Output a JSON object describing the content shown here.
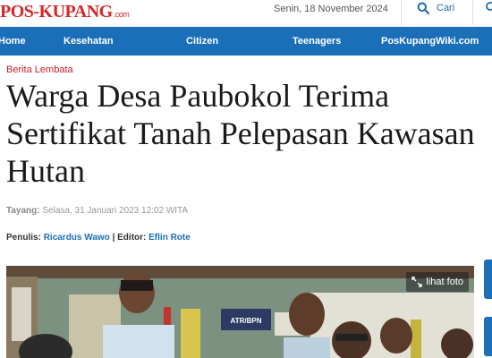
{
  "header": {
    "logo_text": "POS-KUPANG",
    "logo_suffix": ".com",
    "date": "Senin, 18 November 2024",
    "search_label": "Cari"
  },
  "nav": {
    "items": [
      {
        "label": "Home"
      },
      {
        "label": "Kesehatan"
      },
      {
        "label": "Citizen"
      },
      {
        "label": "Teenagers"
      },
      {
        "label": "PosKupangWiki.com"
      }
    ]
  },
  "article": {
    "section": "Berita Lembata",
    "title": "Warga Desa Paubokol Terima Sertifikat Tanah Pelepasan Kawasan Hutan",
    "tayang_label": "Tayang:",
    "tayang_value": "Selasa, 31 Januari 2023 12:02 WITA",
    "penulis_label": "Penulis:",
    "penulis": "Ricardus Wawo",
    "editor_label": "| Editor:",
    "editor": "Eflin Rote",
    "photo": {
      "button_label": "lihat foto",
      "sign_text": "ATR/BPN"
    }
  },
  "colors": {
    "brand_red": "#d8262b",
    "nav_blue": "#1a6fb8",
    "section_red": "#c81d25"
  }
}
